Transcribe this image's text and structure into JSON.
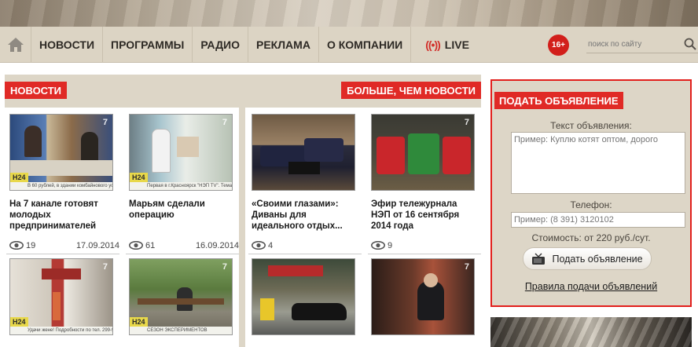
{
  "nav": {
    "items": [
      "НОВОСТИ",
      "ПРОГРАММЫ",
      "РАДИО",
      "РЕКЛАМА",
      "О КОМПАНИИ"
    ],
    "live_label": "LIVE",
    "age_rating": "16+",
    "search_placeholder": "поиск по сайту"
  },
  "sections": {
    "left_label": "НОВОСТИ",
    "right_label": "БОЛЬШЕ, ЧЕМ НОВОСТИ"
  },
  "cards": [
    {
      "title": "На 7 канале готовят молодых предпринимателей",
      "views": "19",
      "date": "17.09.2014",
      "ticker": "В 60 рублей, в здании комбайнового устрой"
    },
    {
      "title": "Марьям сделали операцию",
      "views": "61",
      "date": "16.09.2014",
      "ticker": "Первая в г.Красноярск \"НЭП ТV\". Тема"
    },
    {
      "title": "«Своими глазами»: Диваны для идеального отдых...",
      "views": "4",
      "date": ""
    },
    {
      "title": "Эфир тележурнала НЭП от 16 сентября 2014 года",
      "views": "9",
      "date": ""
    },
    {
      "title": "",
      "views": "",
      "date": "",
      "ticker": "Удачи жене! Подробности по тел. 299-99-99"
    },
    {
      "title": "",
      "views": "",
      "date": "",
      "ticker": "СЕЗОН ЭКСПЕРИМЕНТОВ"
    },
    {
      "title": "",
      "views": "",
      "date": ""
    },
    {
      "title": "",
      "views": "",
      "date": ""
    }
  ],
  "ad_form": {
    "title": "ПОДАТЬ ОБЪЯВЛЕНИЕ",
    "text_label": "Текст объявления:",
    "text_placeholder": "Пример: Куплю котят оптом, дорого",
    "phone_label": "Телефон:",
    "phone_placeholder": "Пример: (8 391) 3120102",
    "cost_text": "Стоимость: от 220 руб./сут.",
    "submit_label": "Подать объявление",
    "rules_link": "Правила подачи объявлений"
  },
  "colors": {
    "accent_red": "#e02a26",
    "panel_beige": "#ddd6c7"
  }
}
